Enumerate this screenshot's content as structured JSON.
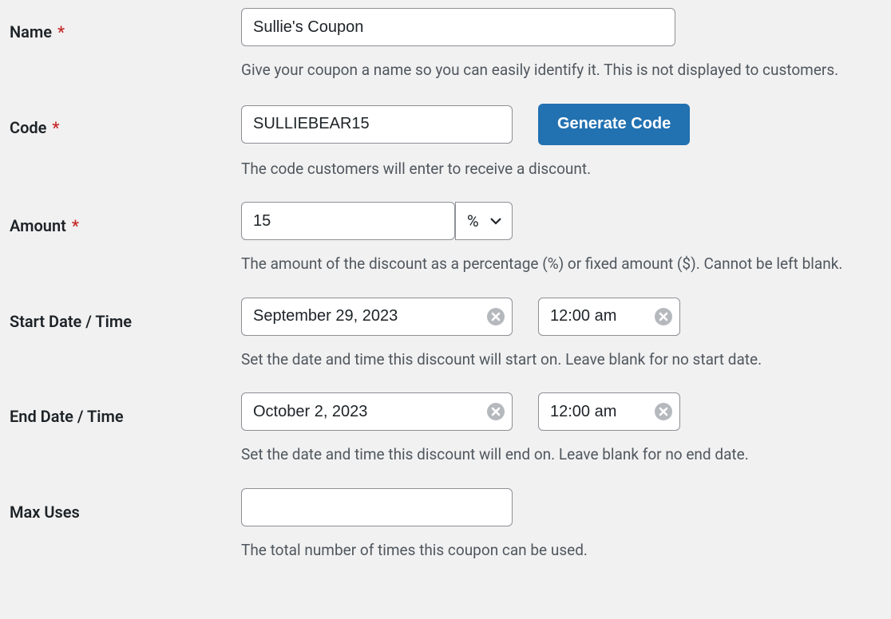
{
  "name": {
    "label": "Name",
    "required": true,
    "value": "Sullie's Coupon",
    "help": "Give your coupon a name so you can easily identify it. This is not displayed to customers."
  },
  "code": {
    "label": "Code",
    "required": true,
    "value": "SULLIEBEAR15",
    "button": "Generate Code",
    "help": "The code customers will enter to receive a discount."
  },
  "amount": {
    "label": "Amount",
    "required": true,
    "value": "15",
    "unit": "%",
    "help": "The amount of the discount as a percentage (%) or fixed amount ($). Cannot be left blank."
  },
  "start": {
    "label": "Start Date / Time",
    "date": "September 29, 2023",
    "time": "12:00 am",
    "help": "Set the date and time this discount will start on. Leave blank for no start date."
  },
  "end": {
    "label": "End Date / Time",
    "date": "October 2, 2023",
    "time": "12:00 am",
    "help": "Set the date and time this discount will end on. Leave blank for no end date."
  },
  "max": {
    "label": "Max Uses",
    "value": "",
    "help": "The total number of times this coupon can be used."
  }
}
